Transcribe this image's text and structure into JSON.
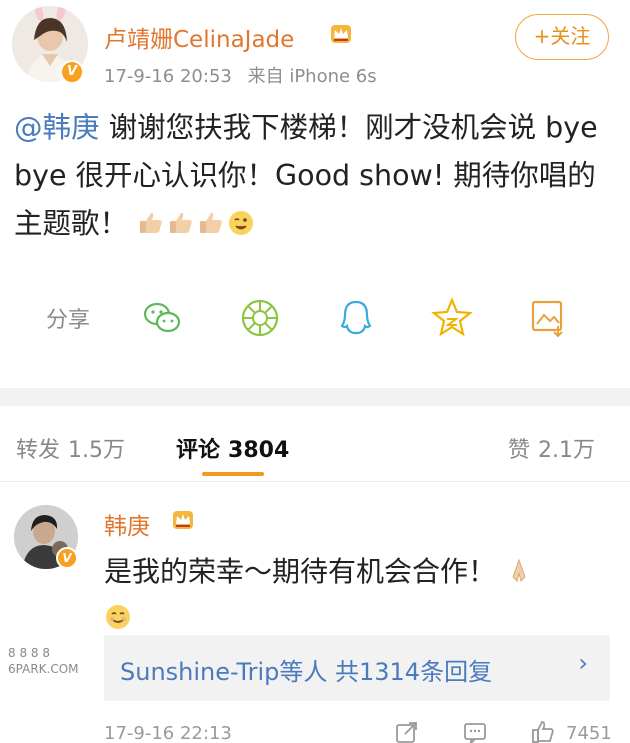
{
  "post": {
    "author": "卢靖姗CelinaJade",
    "verified_badge": "V",
    "follow_button": "+关注",
    "time": "17-9-16 20:53",
    "source": "来自 iPhone 6s",
    "content": {
      "mention": "@韩庚",
      "text": " 谢谢您扶我下楼梯！刚才没机会说 bye bye 很开心认识你！Good show! 期待你唱的主题歌！"
    },
    "emojis": [
      "thumbs-up-icon",
      "thumbs-up-icon",
      "thumbs-up-icon",
      "wink-face-icon"
    ],
    "share": {
      "label": "分享",
      "targets": [
        "wechat-icon",
        "moments-icon",
        "qq-icon",
        "qzone-icon",
        "save-image-icon"
      ]
    }
  },
  "tabs": {
    "repost_label": "转发",
    "repost_count": "1.5万",
    "comment_label": "评论",
    "comment_count": "3804",
    "like_label": "赞",
    "like_count": "2.1万"
  },
  "comment": {
    "author": "韩庚",
    "verified_badge": "V",
    "text": "是我的荣幸～期待有机会合作！",
    "replies_text": "Sunshine-Trip等人 共1314条回复",
    "replies_chevron": "›",
    "time": "17-9-16 22:13",
    "like_count": "7451",
    "watermark": "8 8 8 8 6PARK.COM"
  },
  "colors": {
    "name": "#e2762d",
    "link": "#4a7bbf",
    "accent": "#f39a1c",
    "badge": "#f7a11d",
    "muted": "#8e8e8e",
    "band": "#f2f2f2"
  }
}
